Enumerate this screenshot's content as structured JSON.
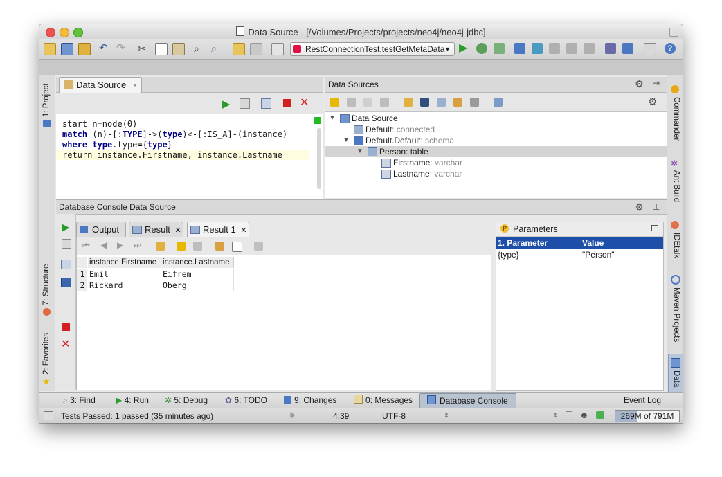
{
  "window": {
    "title": "Data Source - [/Volumes/Projects/projects/neo4j/neo4j-jdbc]"
  },
  "toolbar": {
    "run_config": "RestConnectionTest.testGetMetaData"
  },
  "left_tool_windows": [
    "1: Project",
    "7: Structure",
    "2: Favorites"
  ],
  "right_tool_windows": [
    "Commander",
    "Ant Build",
    "IDEtalk",
    "Maven Projects",
    "Data"
  ],
  "editor": {
    "tab_label": "Data Source",
    "lines": [
      [
        {
          "t": "start n=node(0)",
          "k": false
        }
      ],
      [
        {
          "t": "match",
          "k": true
        },
        {
          "t": " (n)-[:",
          "k": false
        },
        {
          "t": "TYPE",
          "k": true
        },
        {
          "t": "]->(",
          "k": false
        },
        {
          "t": "type",
          "k": true
        },
        {
          "t": ")<-[:IS_A]-(instance)",
          "k": false
        }
      ],
      [
        {
          "t": "where",
          "k": true
        },
        {
          "t": " ",
          "k": false
        },
        {
          "t": "type",
          "k": true
        },
        {
          "t": ".type={",
          "k": false
        },
        {
          "t": "type",
          "k": true
        },
        {
          "t": "}",
          "k": false
        }
      ],
      [
        {
          "t": "return instance.Firstname, instance.Lastname",
          "k": false
        }
      ]
    ]
  },
  "data_sources": {
    "header": "Data Sources",
    "tree": [
      {
        "label": "Data Source",
        "detail": "",
        "indent": 0,
        "arrow": "▼",
        "icon": "database-icon"
      },
      {
        "label": "Default",
        "detail": ": connected",
        "indent": 1,
        "arrow": "",
        "icon": "connection-icon"
      },
      {
        "label": "Default.Default",
        "detail": ": schema",
        "indent": 1,
        "arrow": "▼",
        "icon": "schema-icon"
      },
      {
        "label": "Person",
        "detail": ": table",
        "indent": 2,
        "arrow": "▼",
        "icon": "table-icon",
        "selected": true
      },
      {
        "label": "Firstname",
        "detail": ": varchar",
        "indent": 3,
        "arrow": "",
        "icon": "column-icon"
      },
      {
        "label": "Lastname",
        "detail": ": varchar",
        "indent": 3,
        "arrow": "",
        "icon": "column-icon"
      }
    ]
  },
  "console": {
    "header": "Database Console Data Source",
    "tabs": [
      "Output",
      "Result",
      "Result 1"
    ],
    "columns": [
      "instance.Firstname",
      "instance.Lastname"
    ],
    "rows": [
      {
        "n": "1",
        "first": "Emil",
        "last": "Eifrem"
      },
      {
        "n": "2",
        "first": "Rickard",
        "last": "Oberg"
      }
    ]
  },
  "parameters": {
    "title": "Parameters",
    "col_param": "1. Parameter",
    "col_value": "Value",
    "rows": [
      {
        "param": "{type}",
        "value": "\"Person\""
      }
    ]
  },
  "bottom_tools": {
    "find_num": "3",
    "find": ": Find",
    "run_num": "4",
    "run": ": Run",
    "debug_num": "5",
    "debug": ": Debug",
    "todo_num": "6",
    "todo": ": TODO",
    "changes_num": "9",
    "changes": ": Changes",
    "messages_num": "0",
    "messages": ": Messages",
    "db_console": "Database Console",
    "event_log": "Event Log"
  },
  "status": {
    "message": "Tests Passed: 1 passed (35 minutes ago)",
    "position": "4:39",
    "encoding": "UTF-8",
    "memory": "269M of 791M",
    "memory_used_fraction": 0.34
  },
  "colors": {
    "accent": "#1e4fa8",
    "run_green": "#2a9a2a",
    "stop_red": "#d22020"
  }
}
